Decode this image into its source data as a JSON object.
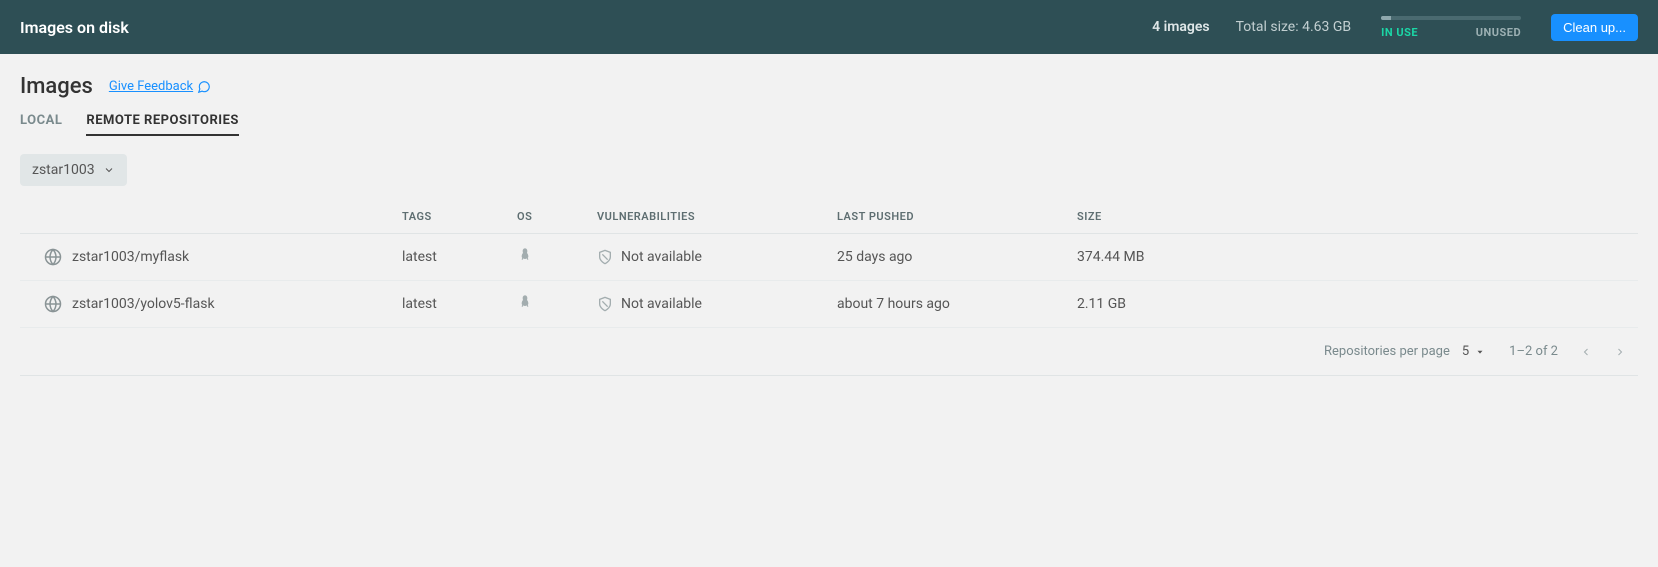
{
  "topbar": {
    "title": "Images on disk",
    "image_count": "4 images",
    "total_size": "Total size: 4.63 GB",
    "in_use_label": "IN USE",
    "unused_label": "UNUSED",
    "cleanup_label": "Clean up..."
  },
  "page": {
    "title": "Images",
    "feedback_label": "Give Feedback"
  },
  "tabs": {
    "local": "LOCAL",
    "remote": "REMOTE REPOSITORIES"
  },
  "dropdown": {
    "selected": "zstar1003"
  },
  "columns": {
    "tags": "TAGS",
    "os": "OS",
    "vulnerabilities": "VULNERABILITIES",
    "last_pushed": "LAST PUSHED",
    "size": "SIZE"
  },
  "rows": [
    {
      "name": "zstar1003/myflask",
      "tag": "latest",
      "vulnerabilities": "Not available",
      "last_pushed": "25 days ago",
      "size": "374.44 MB"
    },
    {
      "name": "zstar1003/yolov5-flask",
      "tag": "latest",
      "vulnerabilities": "Not available",
      "last_pushed": "about 7 hours ago",
      "size": "2.11 GB"
    }
  ],
  "pagination": {
    "per_page_label": "Repositories per page",
    "per_page_value": "5",
    "range": "1–2 of 2"
  }
}
